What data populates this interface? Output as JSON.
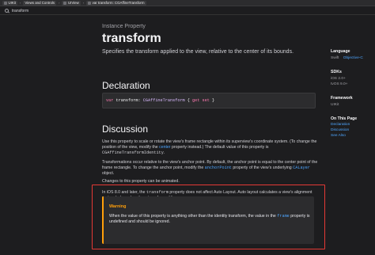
{
  "breadcrumbs": [
    "UIKit",
    "Views and Controls",
    "UIView",
    "var transform: CGAffineTransform"
  ],
  "search": {
    "query": "transform"
  },
  "article": {
    "eyebrow": "Instance Property",
    "title": "transform",
    "abstract": "Specifies the transform applied to the view, relative to the center of its bounds.",
    "declaration_heading": "Declaration",
    "code": {
      "kw_var": "var",
      "name": "transform",
      "colon": ":",
      "type": "CGAffineTransform",
      "open": "{",
      "kw_get": "get",
      "kw_set": "set",
      "close": "}"
    },
    "discussion_heading": "Discussion",
    "p1": {
      "a": "Use this property to scale or rotate the view’s frame rectangle within its superview’s coordinate system. (To change the position of the view, modify the ",
      "link": "center",
      "b": " property instead.) The default value of this property is ",
      "code": "CGAffineTransformIdentity",
      "c": "."
    },
    "p2": {
      "a": "Transformations occur relative to the view’s anchor point. By default, the anchor point is equal to the center point of the frame rectangle. To change the anchor point, modify the ",
      "link1": "anchorPoint",
      "b": " property of the view’s underlying ",
      "link2": "CALayer",
      "c": " object."
    },
    "p3": "Changes to this property can be animated.",
    "p4": {
      "a": "In iOS 8.0 and later, the ",
      "code": "transform",
      "b": " property does not affect Auto Layout. Auto layout calculates a view’s alignment rectangle based on its untransformed frame."
    },
    "warning": {
      "title": "Warning",
      "a": "When the value of this property is anything other than the identity transform, the value in the ",
      "link": "frame",
      "b": " property is undefined and should be ignored."
    }
  },
  "sidebar": {
    "language_heading": "Language",
    "language_swift": "Swift",
    "language_objc": "Objective-C",
    "sdks_heading": "SDKs",
    "sdk1": "iOS 2.0+",
    "sdk2": "tvOS 9.0+",
    "framework_heading": "Framework",
    "framework": "UIKit",
    "onthispage_heading": "On This Page",
    "links": [
      "Declaration",
      "Discussion",
      "See Also"
    ]
  },
  "colors": {
    "background": "#1d1d1f",
    "link": "#4ea6ff",
    "warning": "#ff9f0a",
    "highlight": "#e53935"
  }
}
